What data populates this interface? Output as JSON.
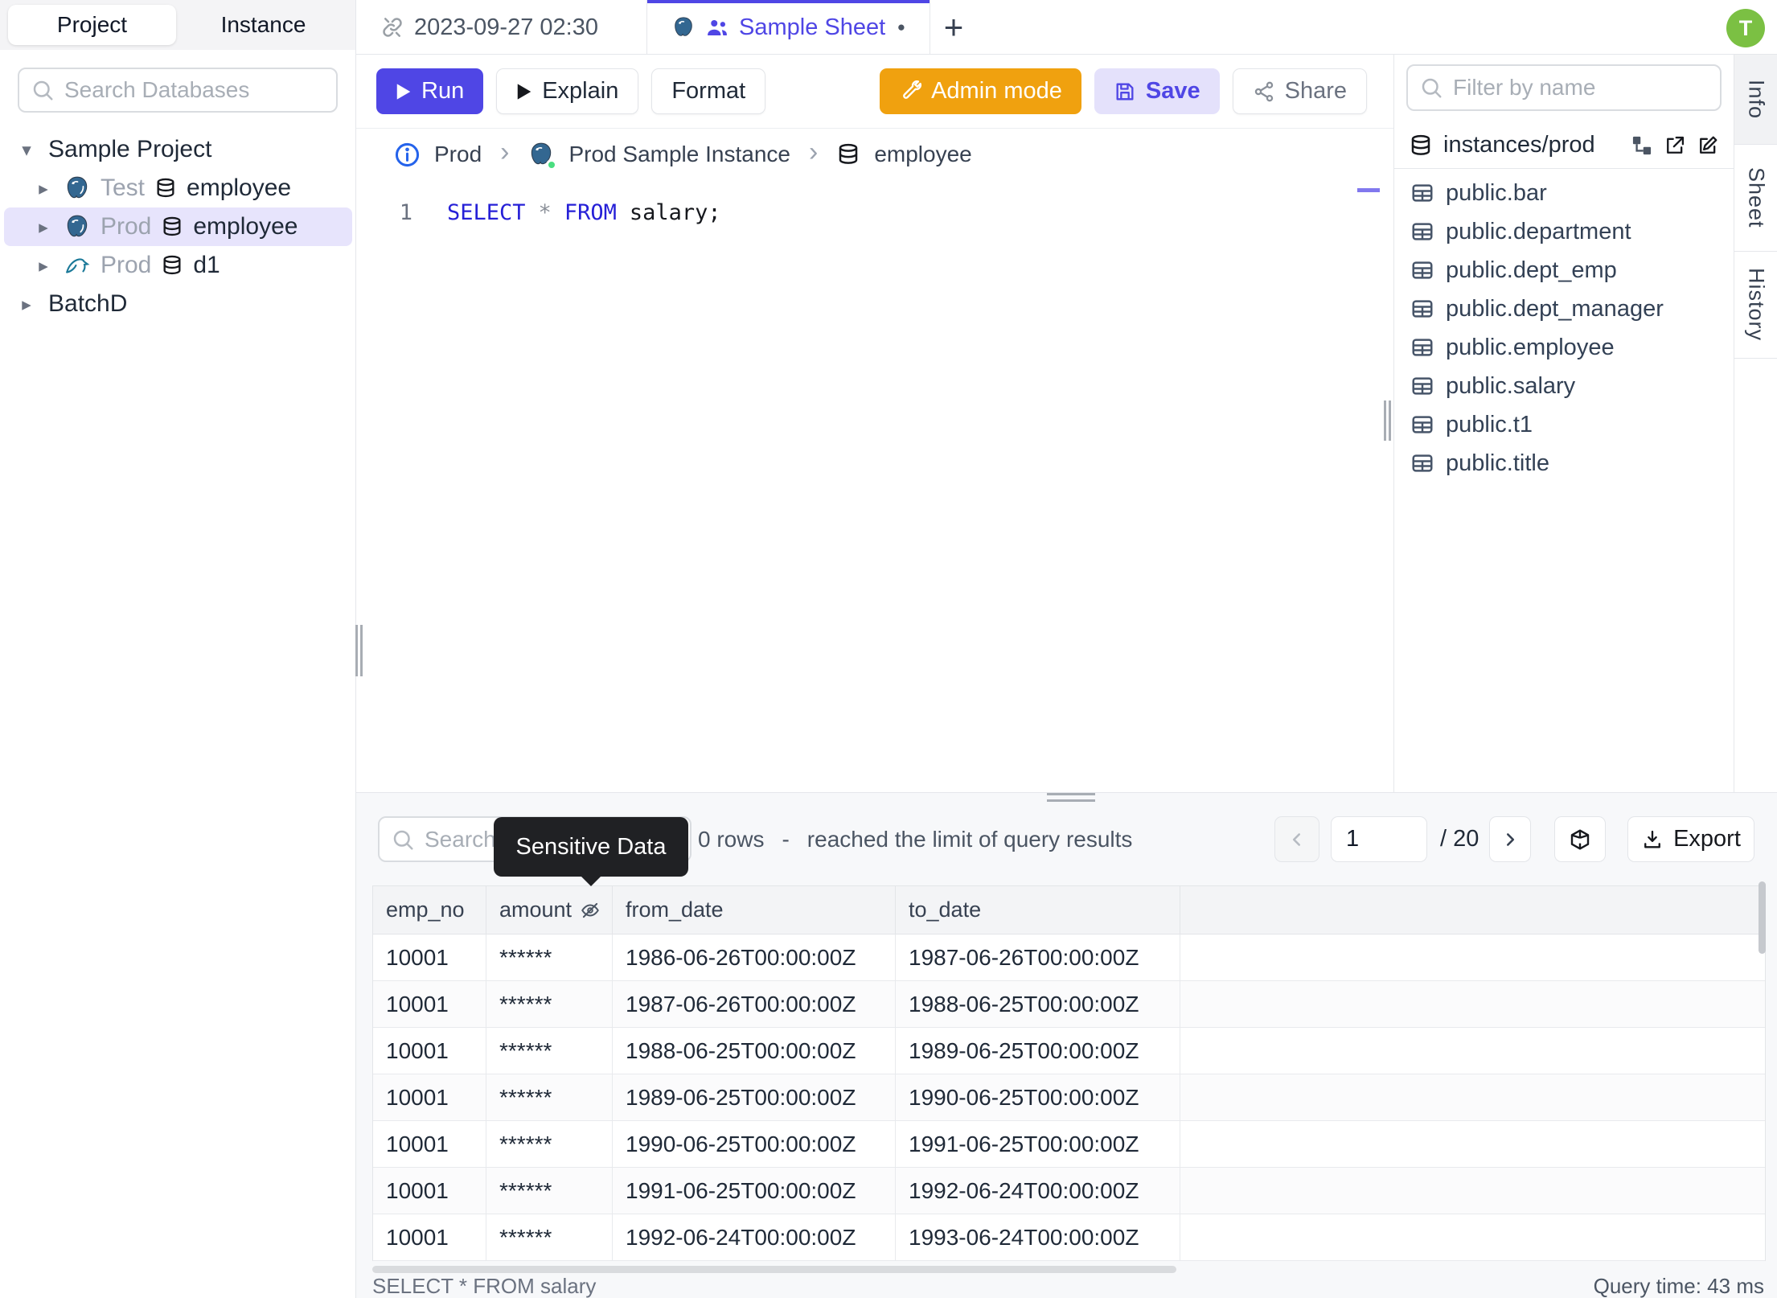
{
  "icons": {
    "caret_down": "▾",
    "caret_right": "▸",
    "plus": "+",
    "dirty_dot": "●",
    "breadcrumb_separator": "›"
  },
  "colors": {
    "accent_indigo": "#4f46e5",
    "admin_orange": "#f0a10f",
    "avatar_green": "#7bc043",
    "keyword_blue": "#2620d7",
    "tooltip_bg": "#202124",
    "selected_tree_bg": "#e7e4fc",
    "status_green": "#4ade80"
  },
  "avatar": {
    "initial": "T"
  },
  "left_sidebar": {
    "tabs": [
      {
        "label": "Project"
      },
      {
        "label": "Instance"
      }
    ],
    "search_placeholder": "Search Databases",
    "tree": {
      "project_label": "Sample Project",
      "databases": [
        {
          "engine": "postgres",
          "environment": "Test",
          "name": "employee",
          "selected": false
        },
        {
          "engine": "postgres",
          "environment": "Prod",
          "name": "employee",
          "selected": true
        },
        {
          "engine": "mysql",
          "environment": "Prod",
          "name": "d1",
          "selected": false
        }
      ],
      "collapsed_project_label": "BatchD"
    }
  },
  "tab_bar": {
    "history_tab_label": "2023-09-27 02:30",
    "active_tab_label": "Sample Sheet"
  },
  "toolbar": {
    "run": "Run",
    "explain": "Explain",
    "format": "Format",
    "admin_mode": "Admin mode",
    "save": "Save",
    "share": "Share"
  },
  "breadcrumb": {
    "environment": "Prod",
    "instance": "Prod Sample Instance",
    "database": "employee"
  },
  "editor": {
    "line_number": "1",
    "keyword_select": "SELECT",
    "star": "*",
    "keyword_from": "FROM",
    "rest": "salary;"
  },
  "right_panel": {
    "filter_placeholder": "Filter by name",
    "header_label": "instances/prod",
    "tables": [
      "public.bar",
      "public.department",
      "public.dept_emp",
      "public.dept_manager",
      "public.employee",
      "public.salary",
      "public.t1",
      "public.title"
    ]
  },
  "side_tabs": {
    "info": "Info",
    "sheet": "Sheet",
    "history": "History"
  },
  "results": {
    "search_placeholder": "Search",
    "tooltip_label": "Sensitive Data",
    "rows_count_visible": "0 rows",
    "separator": "-",
    "limit_message": "reached the limit of query results",
    "page_number": "1",
    "page_total": "/ 20",
    "export_label": "Export",
    "columns": [
      "emp_no",
      "amount",
      "from_date",
      "to_date"
    ],
    "masked_column": "amount",
    "rows": [
      [
        "10001",
        "******",
        "1986-06-26T00:00:00Z",
        "1987-06-26T00:00:00Z"
      ],
      [
        "10001",
        "******",
        "1987-06-26T00:00:00Z",
        "1988-06-25T00:00:00Z"
      ],
      [
        "10001",
        "******",
        "1988-06-25T00:00:00Z",
        "1989-06-25T00:00:00Z"
      ],
      [
        "10001",
        "******",
        "1989-06-25T00:00:00Z",
        "1990-06-25T00:00:00Z"
      ],
      [
        "10001",
        "******",
        "1990-06-25T00:00:00Z",
        "1991-06-25T00:00:00Z"
      ],
      [
        "10001",
        "******",
        "1991-06-25T00:00:00Z",
        "1992-06-24T00:00:00Z"
      ],
      [
        "10001",
        "******",
        "1992-06-24T00:00:00Z",
        "1993-06-24T00:00:00Z"
      ]
    ],
    "status_query": "SELECT * FROM salary",
    "status_time": "Query time: 43 ms"
  }
}
